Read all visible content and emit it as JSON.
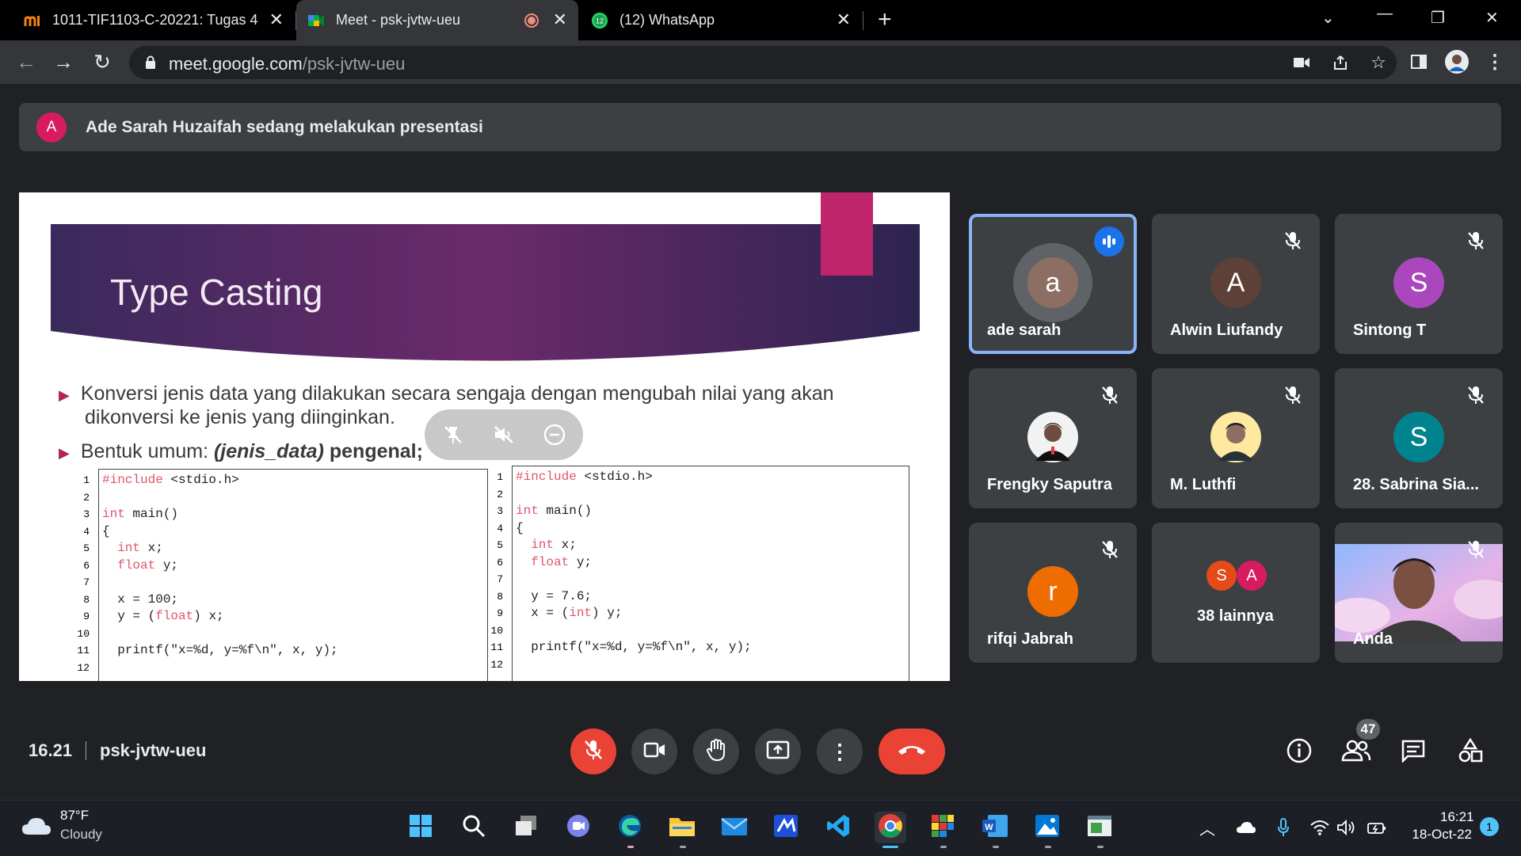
{
  "browser": {
    "tabs": [
      {
        "title": "1011-TIF1103-C-20221: Tugas 4",
        "icon": "moodle-icon"
      },
      {
        "title": "Meet - psk-jvtw-ueu",
        "icon": "google-meet-icon",
        "recording": true
      },
      {
        "title": "(12) WhatsApp",
        "icon": "whatsapp-icon",
        "badge": "12"
      }
    ],
    "url_host": "meet.google.com",
    "url_path": "/psk-jvtw-ueu"
  },
  "banner": {
    "avatar_letter": "A",
    "text": "Ade Sarah Huzaifah sedang melakukan presentasi"
  },
  "slide": {
    "title": "Type Casting",
    "bullet1_line1": "Konversi jenis data yang dilakukan secara sengaja dengan mengubah nilai yang akan",
    "bullet1_line2": "dikonversi ke jenis yang diinginkan.",
    "bullet2_prefix": "Bentuk umum: ",
    "bullet2_code": "(jenis_data)",
    "bullet2_suffix": " pengenal;",
    "code_left": [
      {
        "n": "1",
        "t": "#include <stdio.h>"
      },
      {
        "n": "2",
        "t": ""
      },
      {
        "n": "3",
        "t": "int main()"
      },
      {
        "n": "4",
        "t": "{"
      },
      {
        "n": "5",
        "t": "  int x;"
      },
      {
        "n": "6",
        "t": "  float y;"
      },
      {
        "n": "7",
        "t": ""
      },
      {
        "n": "8",
        "t": "  x = 100;"
      },
      {
        "n": "9",
        "t": "  y = (float) x;"
      },
      {
        "n": "10",
        "t": ""
      },
      {
        "n": "11",
        "t": "  printf(\"x=%d, y=%f\\n\", x, y);"
      },
      {
        "n": "12",
        "t": ""
      }
    ],
    "code_right": [
      {
        "n": "1",
        "t": "#include <stdio.h>"
      },
      {
        "n": "2",
        "t": ""
      },
      {
        "n": "3",
        "t": "int main()"
      },
      {
        "n": "4",
        "t": "{"
      },
      {
        "n": "5",
        "t": "  int x;"
      },
      {
        "n": "6",
        "t": "  float y;"
      },
      {
        "n": "7",
        "t": ""
      },
      {
        "n": "8",
        "t": "  y = 7.6;"
      },
      {
        "n": "9",
        "t": "  x = (int) y;"
      },
      {
        "n": "10",
        "t": ""
      },
      {
        "n": "11",
        "t": "  printf(\"x=%d, y=%f\\n\", x, y);"
      },
      {
        "n": "12",
        "t": ""
      }
    ]
  },
  "participants": [
    {
      "name": "ade sarah",
      "avatar": "a",
      "color": "#8d6e63",
      "speaking": true
    },
    {
      "name": "Alwin Liufandy",
      "avatar": "A",
      "color": "#5d4037",
      "muted": true
    },
    {
      "name": "Sintong T",
      "avatar": "S",
      "color": "#ab47bc",
      "muted": true
    },
    {
      "name": "Frengky Saputra",
      "avatar": "photo",
      "muted": true
    },
    {
      "name": "M. Luthfi",
      "avatar": "photo",
      "muted": true
    },
    {
      "name": "28. Sabrina Sia...",
      "avatar": "S",
      "color": "#00838f",
      "muted": true
    },
    {
      "name": "rifqi Jabrah",
      "avatar": "r",
      "color": "#ef6c00",
      "muted": true
    },
    {
      "name": "38 lainnya",
      "avatar_group": [
        "S",
        "A"
      ],
      "group_colors": [
        "#e64a19",
        "#d81b60"
      ]
    },
    {
      "name": "Anda",
      "avatar": "video",
      "muted": true
    }
  ],
  "meeting": {
    "time": "16.21",
    "code": "psk-jvtw-ueu",
    "participant_count": "47"
  },
  "taskbar": {
    "weather_temp": "87°F",
    "weather_desc": "Cloudy",
    "time": "16:21",
    "date": "18-Oct-22",
    "notifications": "1"
  }
}
